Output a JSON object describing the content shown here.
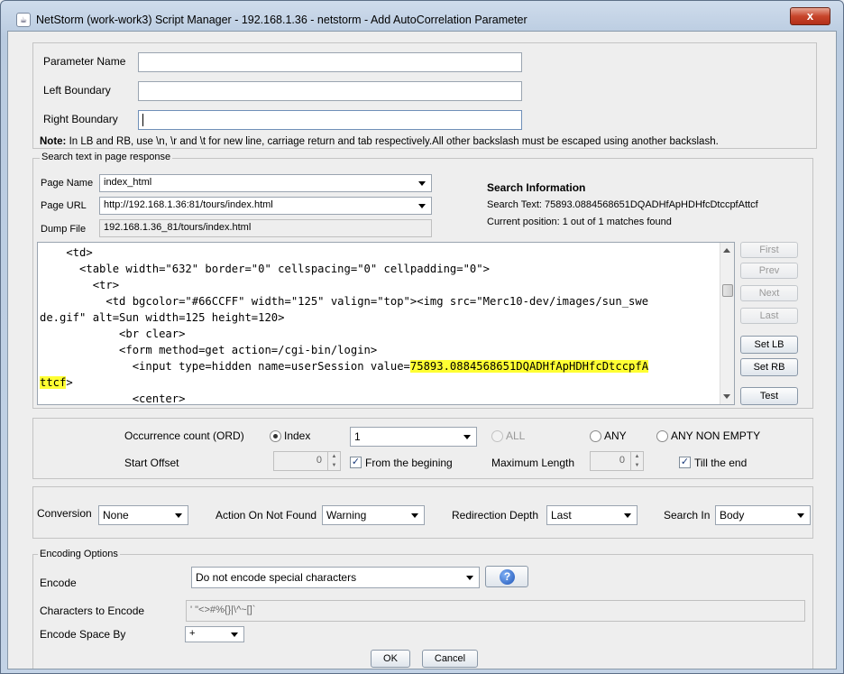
{
  "window": {
    "title": "NetStorm (work-work3) Script Manager - 192.168.1.36 - netstorm - Add AutoCorrelation Parameter",
    "close_glyph": "x"
  },
  "params": {
    "name_label": "Parameter Name",
    "name_value": "",
    "lb_label": "Left Boundary",
    "lb_value": "",
    "rb_label": "Right Boundary",
    "rb_value": "",
    "note_label": "Note:",
    "note_text": " In LB and RB, use \\n, \\r and \\t for new line, carriage return and tab respectively.All other backslash must be escaped using another backslash."
  },
  "search": {
    "legend": "Search text in page response",
    "page_name_label": "Page Name",
    "page_name_value": "index_html",
    "page_url_label": "Page URL",
    "page_url_value": "http://192.168.1.36:81/tours/index.html",
    "dump_file_label": "Dump File",
    "dump_file_value": "192.168.1.36_81/tours/index.html",
    "info_title": "Search Information",
    "search_text_line": "Search Text: 75893.0884568651DQADHfApHDHfcDtccpfAttcf",
    "position_line": "Current position: 1 out of 1 matches found",
    "code_lines": [
      "    <td>",
      "      <table width=\"632\" border=\"0\" cellspacing=\"0\" cellpadding=\"0\">",
      "        <tr>",
      "          <td bgcolor=\"#66CCFF\" width=\"125\" valign=\"top\"><img src=\"Merc10-dev/images/sun_swe",
      "de.gif\" alt=Sun width=125 height=120>",
      "            <br clear>",
      "            <form method=get action=/cgi-bin/login>",
      "              <input type=hidden name=userSession value=",
      "              <center>"
    ],
    "code_highlight_a": "75893.0884568651DQADHfApHDHfcDtccpfA",
    "code_highlight_b": "ttcf",
    "code_tail_b": ">",
    "buttons": {
      "first": "First",
      "prev": "Prev",
      "next": "Next",
      "last": "Last",
      "set_lb": "Set LB",
      "set_rb": "Set RB",
      "test": "Test"
    }
  },
  "occurrence": {
    "label": "Occurrence count (ORD)",
    "index_label": "Index",
    "index_value": "1",
    "all_label": "ALL",
    "any_label": "ANY",
    "any_non_empty_label": "ANY NON EMPTY",
    "start_offset_label": "Start Offset",
    "start_offset_value": "0",
    "from_beginning_label": "From the begining",
    "max_length_label": "Maximum Length",
    "max_length_value": "0",
    "till_end_label": "Till the end",
    "check_glyph": "✓"
  },
  "options": {
    "conversion_label": "Conversion",
    "conversion_value": "None",
    "action_label": "Action On Not Found",
    "action_value": "Warning",
    "redirection_label": "Redirection Depth",
    "redirection_value": "Last",
    "search_in_label": "Search In",
    "search_in_value": "Body"
  },
  "encoding": {
    "legend": "Encoding Options",
    "encode_label": "Encode",
    "encode_value": "Do not encode special characters",
    "help_glyph": "?",
    "chars_label": "Characters to Encode",
    "chars_value": "' \"<>#%{}|\\^~[]`",
    "space_label": "Encode Space By",
    "space_value": "+"
  },
  "footer": {
    "ok": "OK",
    "cancel": "Cancel"
  },
  "colors": {
    "highlight": "#ffff33",
    "close_button": "#c7452b",
    "help_icon": "#1f55b8"
  }
}
